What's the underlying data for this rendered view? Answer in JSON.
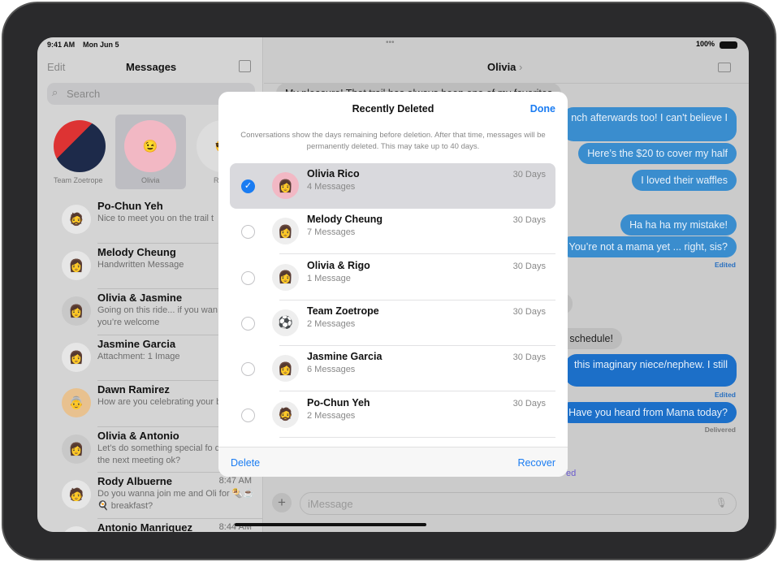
{
  "status": {
    "time": "9:41 AM",
    "date": "Mon Jun 5",
    "battery": "100%"
  },
  "sidebar": {
    "edit": "Edit",
    "title": "Messages",
    "search_placeholder": "Search",
    "pinned": [
      {
        "name": "Team Zoetrope"
      },
      {
        "name": "Olivia"
      },
      {
        "name": "R"
      }
    ],
    "conversations": [
      {
        "name": "Po-Chun Yeh",
        "preview": "Nice to meet you on the trail t",
        "time": ""
      },
      {
        "name": "Melody Cheung",
        "preview": "Handwritten Message",
        "time": ""
      },
      {
        "name": "Olivia & Jasmine",
        "preview": "Going on this ride... if you wan come too you’re welcome",
        "time": ""
      },
      {
        "name": "Jasmine Garcia",
        "preview": "Attachment: 1 Image",
        "time": ""
      },
      {
        "name": "Dawn Ramirez",
        "preview": "How are you celebrating your big day?",
        "time": ""
      },
      {
        "name": "Olivia & Antonio",
        "preview": "Let’s do something special fo dawn at the next meeting ok?",
        "time": ""
      },
      {
        "name": "Rody Albuerne",
        "preview": "Do you wanna join me and Oli for 🌯☕🍳 breakfast?",
        "time": "8:47 AM"
      },
      {
        "name": "Antonio Manriquez",
        "preview": "",
        "time": "8:44 AM"
      }
    ]
  },
  "chat": {
    "title": "Olivia",
    "input_placeholder": "iMessage",
    "messages": [
      {
        "text": "My pleasure! That trail has always been one of my favorites",
        "from": "them"
      },
      {
        "text": "nch afterwards too! I can't believe I",
        "from": "me"
      },
      {
        "text": "Here’s the $20 to cover my half",
        "from": "me"
      },
      {
        "text": "I loved their waffles",
        "from": "me"
      },
      {
        "text": "Ha ha ha my mistake!",
        "from": "me"
      },
      {
        "text": "You’re not a mama yet ... right, sis?",
        "from": "me"
      },
      {
        "text": "!",
        "from": "them"
      },
      {
        "text": "social schedule!",
        "from": "them"
      },
      {
        "text": "this imaginary niece/nephew. I still",
        "from": "me"
      },
      {
        "text": "Have you heard from Mama today?",
        "from": "me"
      }
    ],
    "edited": "Edited",
    "delivered": "Delivered",
    "partial": "ed"
  },
  "modal": {
    "title": "Recently Deleted",
    "done": "Done",
    "info": "Conversations show the days remaining before deletion. After that time, messages will be permanently deleted. This may take up to 40 days.",
    "items": [
      {
        "name": "Olivia Rico",
        "count": "4 Messages",
        "days": "30 Days",
        "selected": true
      },
      {
        "name": "Melody Cheung",
        "count": "7 Messages",
        "days": "30 Days",
        "selected": false
      },
      {
        "name": "Olivia & Rigo",
        "count": "1 Message",
        "days": "30 Days",
        "selected": false
      },
      {
        "name": "Team Zoetrope",
        "count": "2 Messages",
        "days": "30 Days",
        "selected": false
      },
      {
        "name": "Jasmine Garcia",
        "count": "6 Messages",
        "days": "30 Days",
        "selected": false
      },
      {
        "name": "Po-Chun Yeh",
        "count": "2 Messages",
        "days": "30 Days",
        "selected": false
      }
    ],
    "delete": "Delete",
    "recover": "Recover"
  },
  "colors": {
    "accent": "#1a7cf2",
    "bubble": "#3a8dce"
  }
}
